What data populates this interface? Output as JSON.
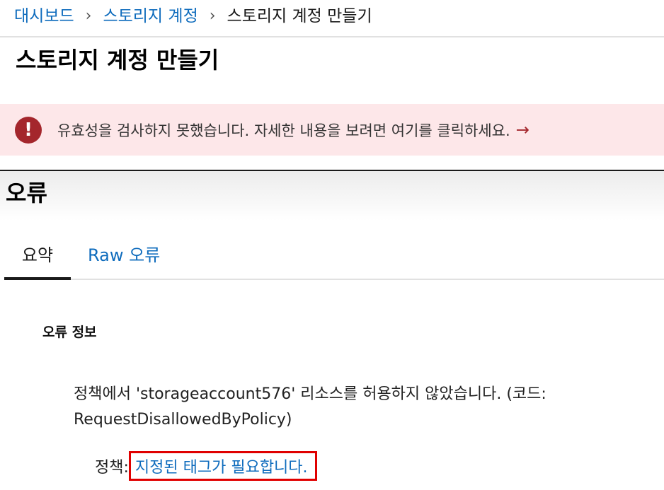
{
  "breadcrumb": {
    "items": [
      "대시보드",
      "스토리지 계정"
    ],
    "current": "스토리지 계정 만들기",
    "separator": "›"
  },
  "page": {
    "title": "스토리지 계정 만들기"
  },
  "banner": {
    "icon": "error-icon",
    "icon_glyph": "!",
    "message": "유효성을 검사하지 못했습니다. 자세한 내용을 보려면 여기를 클릭하세요.",
    "arrow": "→",
    "color": "#a4262c",
    "background": "#fde7e9"
  },
  "blade": {
    "title": "오류",
    "tabs": [
      "요약",
      "Raw 오류"
    ]
  },
  "details": {
    "heading": "오류 정보",
    "message": "정책에서 'storageaccount576' 리소스를 허용하지 않았습니다. (코드: RequestDisallowedByPolicy)",
    "policy_label": "정책:",
    "policy_link": "지정된 태그가 필요합니다."
  },
  "colors": {
    "link": "#0f6cbd",
    "highlight_box": "#e00000"
  }
}
